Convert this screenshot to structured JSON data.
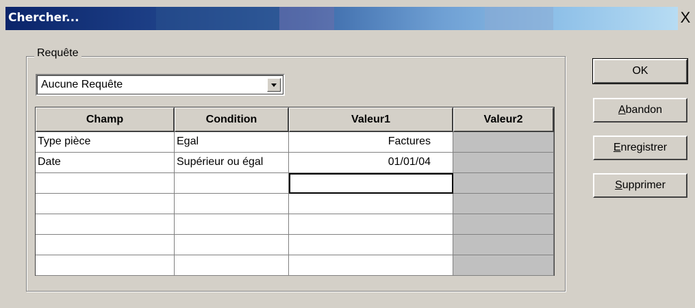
{
  "window": {
    "title": "Chercher...",
    "close_label": "X"
  },
  "query": {
    "group_label": "Requête",
    "selected": "Aucune Requête"
  },
  "grid": {
    "columns": [
      "Champ",
      "Condition",
      "Valeur1",
      "Valeur2"
    ],
    "rows": [
      {
        "champ": "Type pièce",
        "condition": "Egal",
        "valeur1": "Factures",
        "valeur2": ""
      },
      {
        "champ": "Date",
        "condition": "Supérieur ou égal",
        "valeur1": "01/01/04",
        "valeur2": ""
      },
      {
        "champ": "",
        "condition": "",
        "valeur1": "",
        "valeur2": ""
      },
      {
        "champ": "",
        "condition": "",
        "valeur1": "",
        "valeur2": ""
      },
      {
        "champ": "",
        "condition": "",
        "valeur1": "",
        "valeur2": ""
      },
      {
        "champ": "",
        "condition": "",
        "valeur1": "",
        "valeur2": ""
      },
      {
        "champ": "",
        "condition": "",
        "valeur1": "",
        "valeur2": ""
      }
    ]
  },
  "buttons": {
    "ok": {
      "label": "OK"
    },
    "abandon": {
      "first": "A",
      "rest": "bandon"
    },
    "enregistrer": {
      "first": "E",
      "rest": "nregistrer"
    },
    "supprimer": {
      "first": "S",
      "rest": "upprimer"
    }
  },
  "colors": {
    "face": "#d4d0c8",
    "title_start": "#0a246a",
    "title_end": "#b7dcf3"
  }
}
